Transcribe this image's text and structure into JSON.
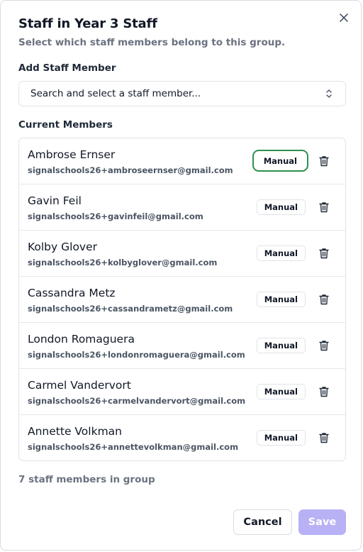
{
  "dialog": {
    "title": "Staff in Year 3 Staff",
    "subtitle": "Select which staff members belong to this group.",
    "close_icon": "close-icon"
  },
  "add_section": {
    "label": "Add Staff Member",
    "select_placeholder": "Search and select a staff member...",
    "caret_icon": "chevron-up-down-icon"
  },
  "members_section": {
    "label": "Current Members",
    "members": [
      {
        "name": "Ambrose Ernser",
        "email": "signalschools26+ambroseernser@gmail.com",
        "badge": "Manual"
      },
      {
        "name": "Gavin Feil",
        "email": "signalschools26+gavinfeil@gmail.com",
        "badge": "Manual"
      },
      {
        "name": "Kolby Glover",
        "email": "signalschools26+kolbyglover@gmail.com",
        "badge": "Manual"
      },
      {
        "name": "Cassandra Metz",
        "email": "signalschools26+cassandrametz@gmail.com",
        "badge": "Manual"
      },
      {
        "name": "London Romaguera",
        "email": "signalschools26+londonromaguera@gmail.com",
        "badge": "Manual"
      },
      {
        "name": "Carmel Vandervort",
        "email": "signalschools26+carmelvandervort@gmail.com",
        "badge": "Manual"
      },
      {
        "name": "Annette Volkman",
        "email": "signalschools26+annettevolkman@gmail.com",
        "badge": "Manual"
      }
    ],
    "count_text": "7 staff members in group",
    "trash_icon": "trash-icon"
  },
  "footer": {
    "cancel_label": "Cancel",
    "save_label": "Save"
  },
  "colors": {
    "focus_ring": "#2f8f4e",
    "save_disabled": "#b8b1f5",
    "muted_text": "#6b7280"
  }
}
